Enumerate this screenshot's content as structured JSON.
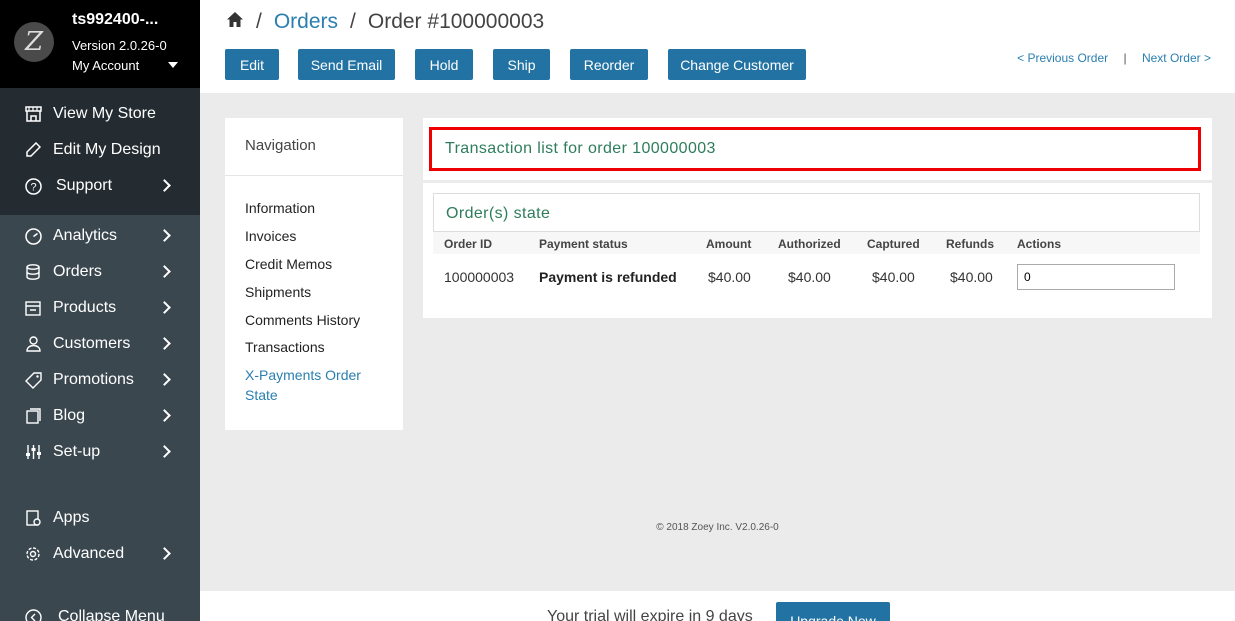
{
  "account": {
    "store_name": "ts992400-...",
    "version": "Version 2.0.26-0",
    "menu_label": "My Account",
    "logo_letter": "Z"
  },
  "sidebar": {
    "top_items": [
      {
        "label": "View My Store",
        "icon": "store-icon"
      },
      {
        "label": "Edit My Design",
        "icon": "pencil-icon"
      },
      {
        "label": "Support",
        "icon": "help-circle-icon",
        "has_submenu": true
      }
    ],
    "items": [
      {
        "label": "Analytics",
        "icon": "gauge-icon",
        "has_submenu": true
      },
      {
        "label": "Orders",
        "icon": "database-icon",
        "has_submenu": true
      },
      {
        "label": "Products",
        "icon": "box-icon",
        "has_submenu": true
      },
      {
        "label": "Customers",
        "icon": "user-icon",
        "has_submenu": true
      },
      {
        "label": "Promotions",
        "icon": "tag-icon",
        "has_submenu": true
      },
      {
        "label": "Blog",
        "icon": "book-icon",
        "has_submenu": true
      },
      {
        "label": "Set-up",
        "icon": "sliders-icon",
        "has_submenu": true
      },
      {
        "label": "Apps",
        "icon": "apps-icon"
      },
      {
        "label": "Advanced",
        "icon": "gear-icon",
        "has_submenu": true
      },
      {
        "label": "Collapse Menu",
        "icon": "collapse-icon"
      }
    ]
  },
  "breadcrumb": {
    "home_icon": "home-icon",
    "separator": "/",
    "orders": "Orders",
    "current": "Order #100000003"
  },
  "toolbar": {
    "edit": "Edit",
    "send_email": "Send Email",
    "hold": "Hold",
    "ship": "Ship",
    "reorder": "Reorder",
    "change_customer": "Change Customer",
    "previous_order": "< Previous Order",
    "divider": "|",
    "next_order": "Next Order >"
  },
  "navigation": {
    "title": "Navigation",
    "links": [
      "Information",
      "Invoices",
      "Credit Memos",
      "Shipments",
      "Comments History",
      "Transactions",
      "X-Payments Order State"
    ]
  },
  "transactions": {
    "title": "Transaction list for order 100000003"
  },
  "order_state": {
    "title": "Order(s) state",
    "columns": [
      "Order ID",
      "Payment status",
      "Amount",
      "Authorized",
      "Captured",
      "Refunds",
      "Actions"
    ],
    "row": {
      "order_id": "100000003",
      "payment_status": "Payment is refunded",
      "amount": "$40.00",
      "authorized": "$40.00",
      "captured": "$40.00",
      "refunds": "$40.00",
      "action_value": "0"
    }
  },
  "footer": {
    "copyright": "© 2018 Zoey Inc. V2.0.26-0"
  },
  "trial": {
    "message": "Your trial will expire in 9 days",
    "upgrade_label": "Upgrade Now"
  },
  "colors": {
    "sidebar": "#3b474f",
    "sidebar_top": "#242c32",
    "button": "#2273a3",
    "link": "#2a7fb0",
    "green_title": "#2e7d5a",
    "highlight": "#ee0000"
  }
}
